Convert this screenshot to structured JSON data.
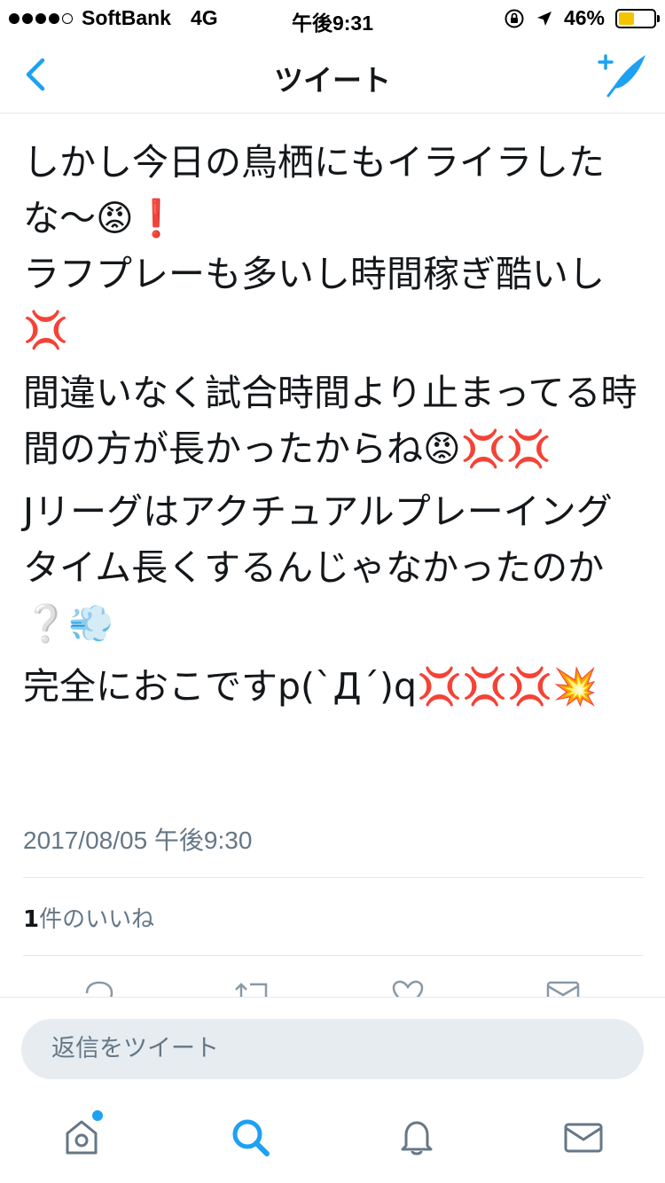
{
  "status_bar": {
    "carrier": "SoftBank",
    "network": "4G",
    "time": "午後9:31",
    "battery": "46%",
    "battery_level": 0.46,
    "battery_color": "#f5c400"
  },
  "nav": {
    "title": "ツイート",
    "back_icon": "chevron-left-icon",
    "compose_icon": "compose-tweet-icon"
  },
  "tweet": {
    "paragraphs": [
      "しかし今日の鳥栖にもイライラしたな〜😡❗\nラフプレーも多いし時間稼ぎ酷いし💢",
      "間違いなく試合時間より止まってる時間の方が長かったからね😡💢💢",
      "Jリーグはアクチュアルプレーイングタイム長くするんじゃなかったのか❔💨",
      "完全におこですp(`Д´)q💢💢💢💥"
    ],
    "timestamp": "2017/08/05 午後9:30",
    "likes_count": "1",
    "likes_label": "件のいいね"
  },
  "reply": {
    "placeholder": "返信をツイート"
  },
  "colors": {
    "accent": "#1da1f2",
    "secondary_text": "#657786",
    "divider": "#e1e8ed"
  },
  "tabbar": {
    "tabs": [
      "home-icon",
      "search-icon",
      "notifications-icon",
      "messages-icon"
    ]
  }
}
